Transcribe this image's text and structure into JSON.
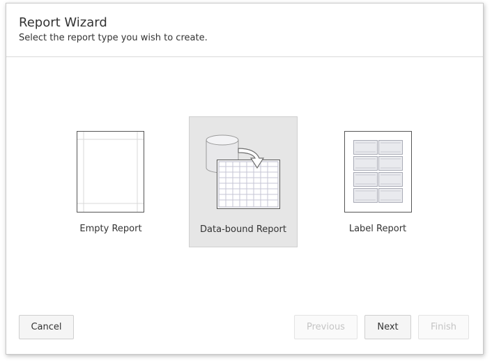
{
  "dialog": {
    "title": "Report Wizard",
    "subtitle": "Select the report type you wish to create."
  },
  "report_types": [
    {
      "label": "Empty Report",
      "selected": false,
      "icon": "empty-report-icon"
    },
    {
      "label": "Data-bound Report",
      "selected": true,
      "icon": "data-bound-report-icon"
    },
    {
      "label": "Label Report",
      "selected": false,
      "icon": "label-report-icon"
    }
  ],
  "buttons": {
    "cancel": "Cancel",
    "previous": "Previous",
    "next": "Next",
    "finish": "Finish"
  },
  "colors": {
    "selected_tile": "#e6e6e6",
    "disabled_text": "#c4c4c4"
  }
}
